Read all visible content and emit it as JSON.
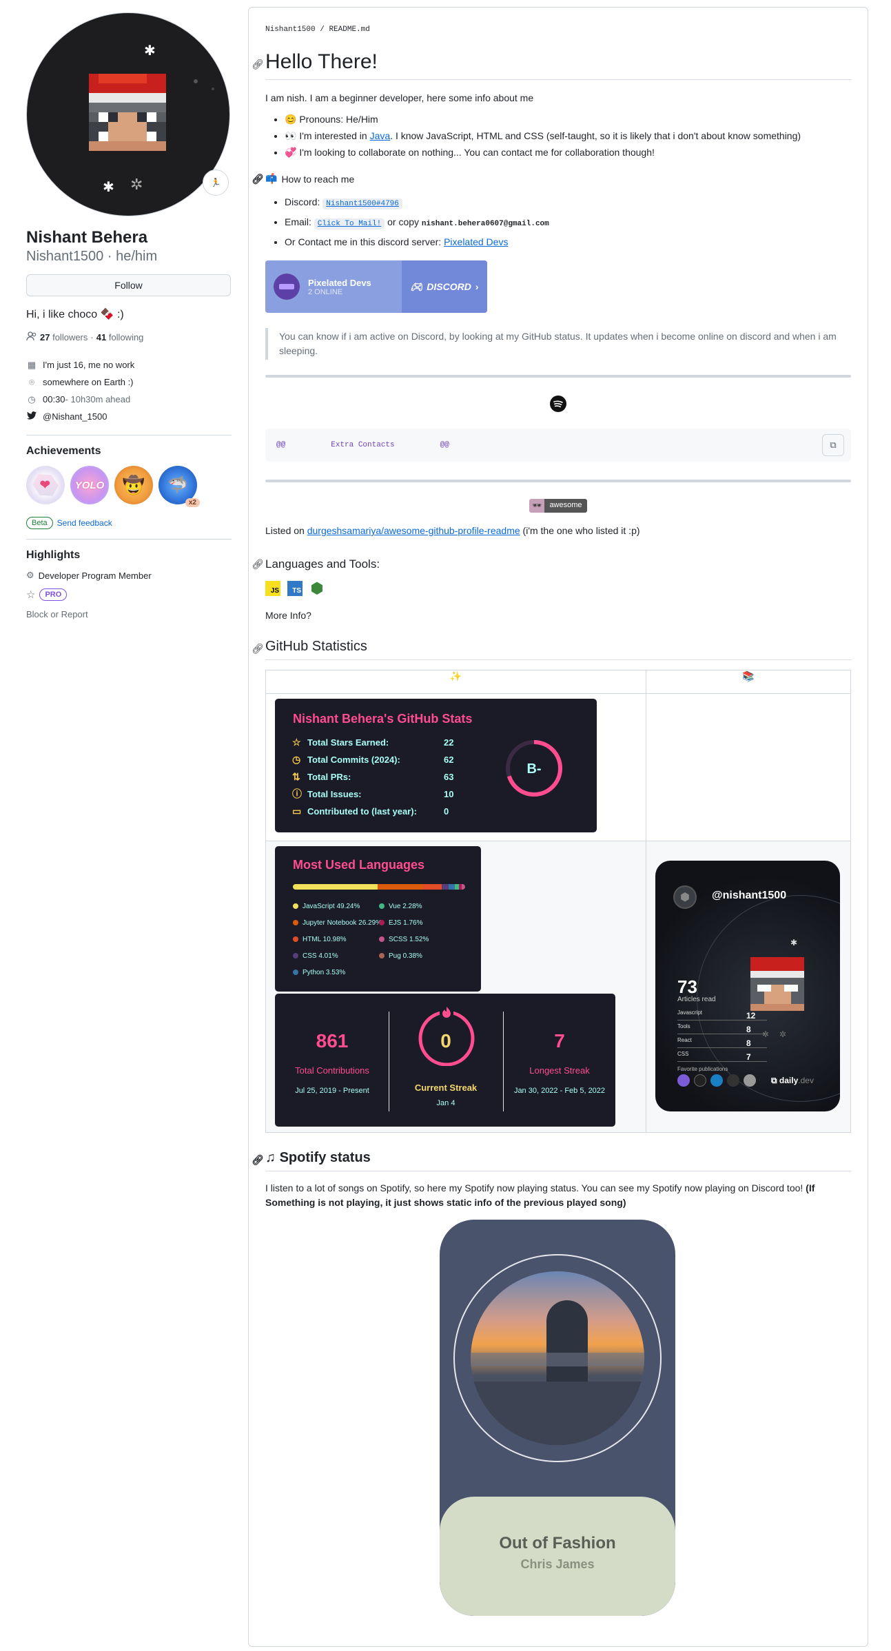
{
  "profile": {
    "name": "Nishant Behera",
    "login_pronouns": "Nishant1500 · he/him",
    "follow_label": "Follow",
    "bio": "Hi, i like choco 🍫 :)",
    "followers_count": "27",
    "followers_label": "followers",
    "separator": "·",
    "following_count": "41",
    "following_label": "following",
    "details": [
      {
        "icon": "building-icon",
        "text": "I'm just 16, me no work"
      },
      {
        "icon": "location-icon",
        "text": "somewhere on Earth :)"
      },
      {
        "icon": "clock-icon",
        "text": "00:30",
        "extra": " - 10h30m ahead"
      },
      {
        "icon": "twitter-icon",
        "text": "@Nishant_1500"
      }
    ],
    "status_icon": "🏃"
  },
  "achievements": {
    "title": "Achievements",
    "badges": [
      {
        "name": "heart-on-sleeve-badge",
        "label": "❤"
      },
      {
        "name": "yolo-badge",
        "label": "YOLO"
      },
      {
        "name": "quickdraw-badge",
        "label": "🤠"
      },
      {
        "name": "pull-shark-badge",
        "label": "🦈"
      }
    ],
    "multiplier": "x2",
    "beta_label": "Beta",
    "feedback_label": "Send feedback"
  },
  "highlights": {
    "title": "Highlights",
    "developer_program": "Developer Program Member",
    "pro_label": "PRO",
    "block_label": "Block or Report"
  },
  "readme": {
    "path_user": "Nishant1500",
    "path_sep": "/",
    "path_file": "README.md",
    "title": "Hello There!",
    "intro": "I am nish. I am a beginner developer, here some info about me",
    "bullets": {
      "pronouns": "😊 Pronouns: He/Him",
      "interest_pre": "👀 I'm interested in ",
      "interest_link": "Java",
      "interest_post": ". I know JavaScript, HTML and CSS (self-taught, so it is likely that i don't about know something)",
      "collab": "💞️ I'm looking to collaborate on nothing... You can contact me for collaboration though!"
    },
    "reach_title": "How to reach me",
    "reach_icon": "📫",
    "discord_label": "Discord:",
    "discord_value": "Nishant1500#4796",
    "email_label": "Email:",
    "email_link": "Click To Mail!",
    "email_or": "or copy",
    "email_value": "nishant.behera0607@gmail.com",
    "server_pre": "Or Contact me in this discord server: ",
    "server_link": "Pixelated Devs",
    "discord_widget": {
      "server": "Pixelated Devs",
      "online": "2 ONLINE",
      "brand": "DISCORD"
    },
    "quote": "You can know if i am active on Discord, by looking at my GitHub status. It updates when i become online on discord and when i am sleeping.",
    "code_line": "@@          Extra Contacts          @@",
    "awesome_badge": "awesome",
    "listed_pre": "Listed on ",
    "listed_link": "durgeshsamariya/awesome-github-profile-readme",
    "listed_post": " (i'm the one who listed it :p)",
    "langs_title": "Languages and Tools:",
    "tools": [
      "JS",
      "TS",
      "⬢"
    ],
    "more_info": "More Info?",
    "stats_title": "GitHub Statistics",
    "table_headers": [
      "✨",
      "📚"
    ],
    "spotify_title": "Spotify status",
    "spotify_text": "I listen to a lot of songs on Spotify, so here my Spotify now playing status. You can see my Spotify now playing on Discord too! ",
    "spotify_bold": "(If Something is not playing, it just shows static info of the previous played song)"
  },
  "github_stats": {
    "title": "Nishant Behera's GitHub Stats",
    "rows": [
      {
        "label": "Total Stars Earned:",
        "value": "22",
        "icon": "☆"
      },
      {
        "label": "Total Commits (2024):",
        "value": "62",
        "icon": "◷"
      },
      {
        "label": "Total PRs:",
        "value": "63",
        "icon": "⇅"
      },
      {
        "label": "Total Issues:",
        "value": "10",
        "icon": "ⓘ"
      },
      {
        "label": "Contributed to (last year):",
        "value": "0",
        "icon": "▭"
      }
    ],
    "grade": "B-",
    "grade_progress": 0.7
  },
  "top_langs": {
    "title": "Most Used Languages",
    "langs": [
      {
        "name": "JavaScript 49.24%",
        "color": "#f1e05a",
        "pct": 49.24
      },
      {
        "name": "Jupyter Notebook 26.29%",
        "color": "#da5b0b",
        "pct": 26.29
      },
      {
        "name": "HTML 10.98%",
        "color": "#e34c26",
        "pct": 10.98
      },
      {
        "name": "CSS 4.01%",
        "color": "#563d7c",
        "pct": 4.01
      },
      {
        "name": "Python 3.53%",
        "color": "#3572a5",
        "pct": 3.53
      },
      {
        "name": "Vue 2.28%",
        "color": "#41b883",
        "pct": 2.28
      },
      {
        "name": "EJS 1.76%",
        "color": "#a91e50",
        "pct": 1.76
      },
      {
        "name": "SCSS 1.52%",
        "color": "#c6538c",
        "pct": 1.52
      },
      {
        "name": "Pug 0.38%",
        "color": "#a86454",
        "pct": 0.38
      }
    ]
  },
  "streak": {
    "total": "861",
    "total_label": "Total Contributions",
    "total_range": "Jul 25, 2019 - Present",
    "current": "0",
    "current_label": "Current Streak",
    "current_date": "Jan 4",
    "longest": "7",
    "longest_label": "Longest Streak",
    "longest_range": "Jan 30, 2022 - Feb 5, 2022"
  },
  "dailydev": {
    "handle": "@nishant1500",
    "articles": "73",
    "articles_label": "Articles read",
    "tags": [
      {
        "name": "Javascript",
        "value": "12"
      },
      {
        "name": "Tools",
        "value": "8"
      },
      {
        "name": "React",
        "value": "8"
      },
      {
        "name": "CSS",
        "value": "7"
      }
    ],
    "favorites_label": "Favorite publications",
    "brand": "daily",
    "brand_suffix": ".dev"
  },
  "spotify": {
    "song": "Out of Fashion",
    "artist": "Chris James"
  }
}
